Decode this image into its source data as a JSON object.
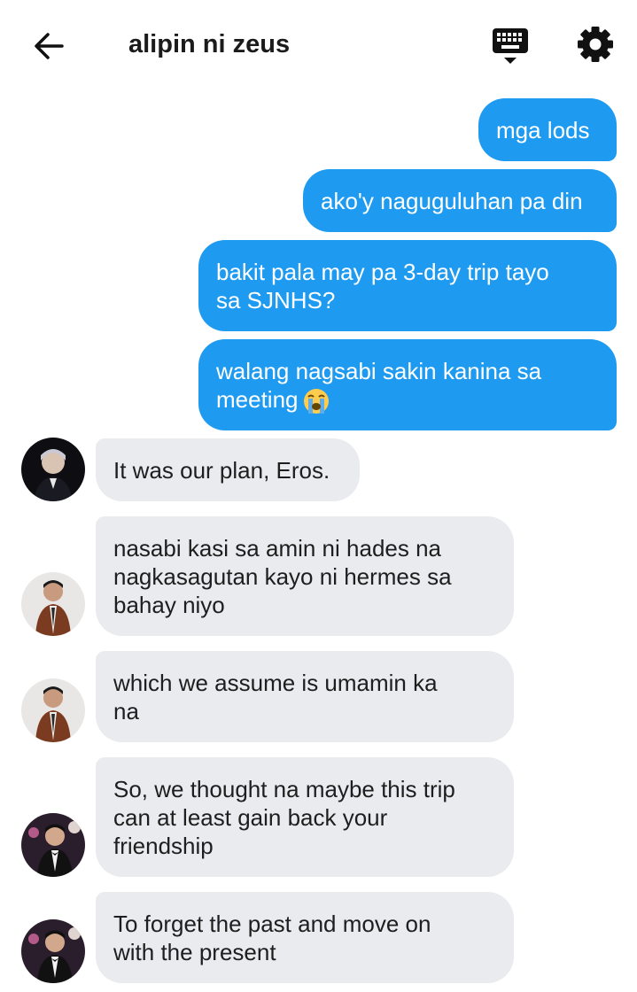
{
  "header": {
    "title": "alipin ni zeus",
    "back_icon": "arrow-left-icon",
    "keyboard_icon": "keyboard-icon",
    "settings_icon": "gear-icon"
  },
  "colors": {
    "outgoing": "#1e9bf0",
    "incoming": "#e9ebee"
  },
  "messages": [
    {
      "from": "me",
      "lines": [
        "mga lods"
      ]
    },
    {
      "from": "me",
      "lines": [
        "ako'y naguguluhan pa din"
      ]
    },
    {
      "from": "me",
      "lines": [
        "bakit pala may pa 3-day trip tayo",
        "sa SJNHS?"
      ]
    },
    {
      "from": "me",
      "lines": [
        "walang nagsabi sakin kanina sa",
        "meeting"
      ],
      "emoji": "loudly-crying-face"
    },
    {
      "from": "other",
      "lines": [
        "It was our plan, Eros."
      ]
    },
    {
      "from": "other",
      "lines": [
        "nasabi kasi sa amin ni hades na",
        "nagkasagutan kayo ni hermes sa",
        "bahay niyo"
      ]
    },
    {
      "from": "other",
      "lines": [
        "which we assume is umamin ka",
        "na"
      ]
    },
    {
      "from": "other",
      "lines": [
        "So, we thought na maybe this trip",
        "can at least gain back your",
        "friendship"
      ]
    },
    {
      "from": "other",
      "lines": [
        "To forget the past and move on",
        "with the present"
      ]
    }
  ]
}
